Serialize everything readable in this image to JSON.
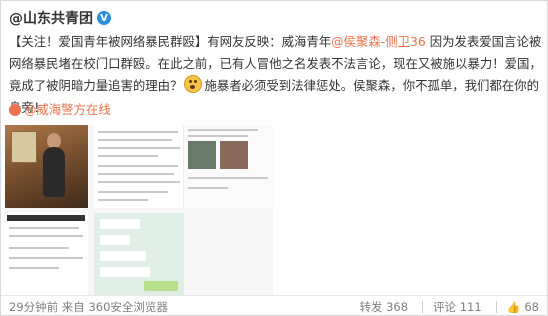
{
  "author": {
    "name": "@山东共青团",
    "verified": "V"
  },
  "post": {
    "prefix": "【关注！爱国青年被网络暴民群殴】有网友反映：威海青年",
    "mention": "@侯聚森-侧卫36",
    "middle": " 因为发表爱国言论被网络暴民堵在校门口群殴。在此之前，已有人冒他之名发表不法言论，现在又被施以暴力！爱国，竟成了被阴暗力量追害的理由？",
    "suffix": "施暴者必须受到法律惩处。侯聚森，你不孤单，我们都在你的身旁！",
    "source_mention": "@威海警方在线"
  },
  "footer": {
    "time": "29分钟前",
    "source": "来自 360安全浏览器",
    "repost_label": "转发",
    "repost_count": "368",
    "comment_label": "评论",
    "comment_count": "111",
    "like_count": "68"
  },
  "icons": {
    "emoji": "shocked-face-emoji-icon",
    "location": "location-dot-icon",
    "repost": "repost-icon",
    "comment": "comment-icon",
    "like": "thumbs-up-icon"
  },
  "colors": {
    "link": "#eb7350",
    "verified": "#2d8de0"
  }
}
